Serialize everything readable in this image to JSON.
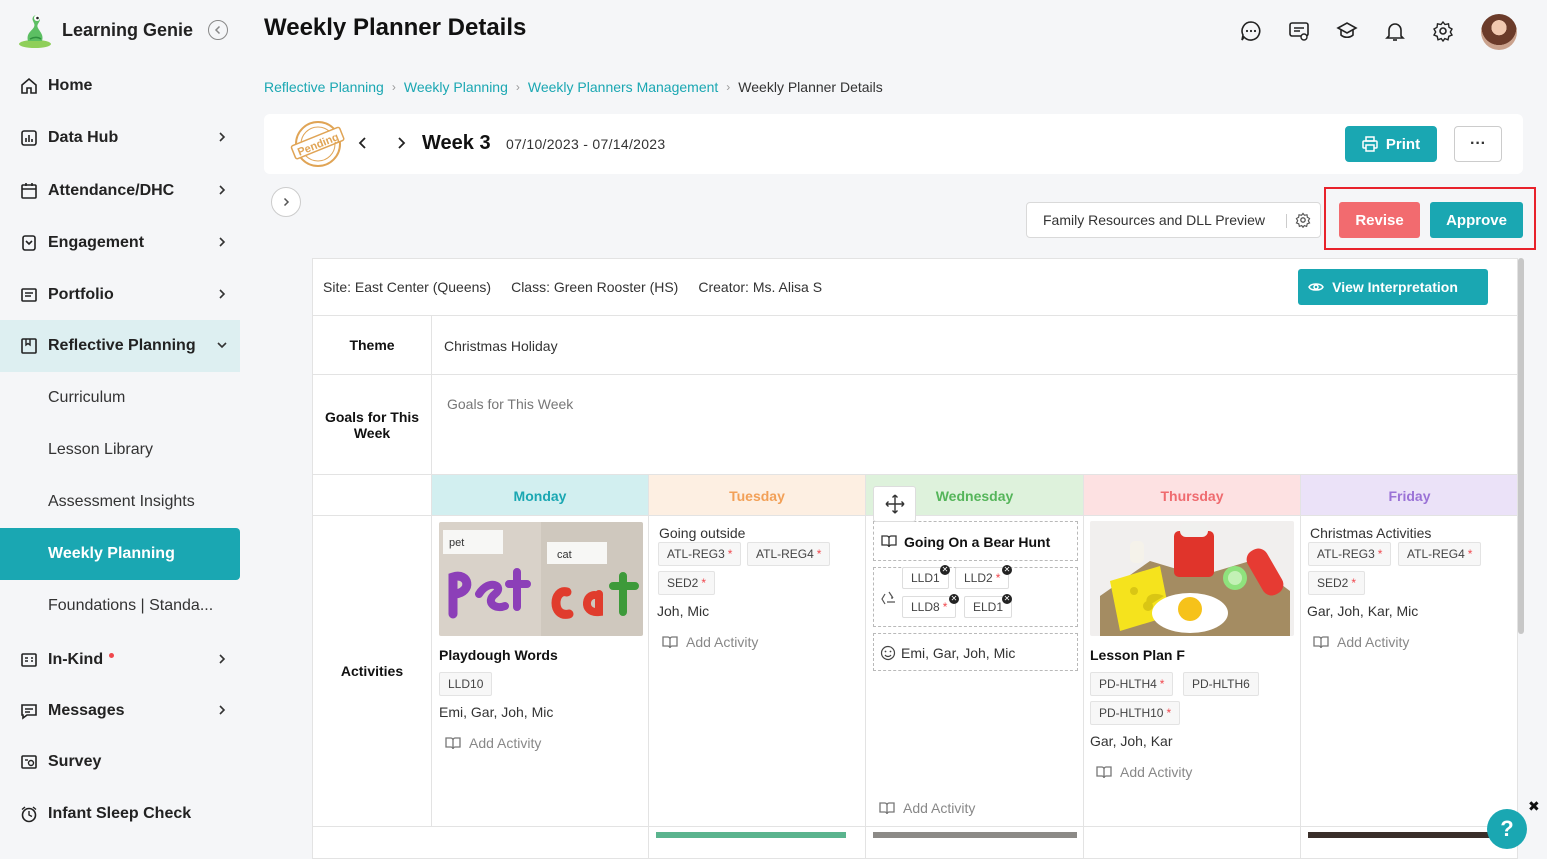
{
  "app": {
    "name": "Learning Genie"
  },
  "sidebar": {
    "items": [
      {
        "label": "Home"
      },
      {
        "label": "Data Hub"
      },
      {
        "label": "Attendance/DHC"
      },
      {
        "label": "Engagement"
      },
      {
        "label": "Portfolio"
      },
      {
        "label": "Reflective Planning"
      },
      {
        "label": "In-Kind"
      },
      {
        "label": "Messages"
      },
      {
        "label": "Survey"
      },
      {
        "label": "Infant Sleep Check"
      }
    ],
    "subitems": [
      {
        "label": "Curriculum"
      },
      {
        "label": "Lesson Library"
      },
      {
        "label": "Assessment Insights"
      },
      {
        "label": "Weekly Planning"
      },
      {
        "label": "Foundations | Standa..."
      }
    ]
  },
  "header": {
    "title": "Weekly Planner Details"
  },
  "breadcrumb": [
    {
      "label": "Reflective Planning"
    },
    {
      "label": "Weekly Planning"
    },
    {
      "label": "Weekly Planners Management"
    },
    {
      "label": "Weekly Planner Details"
    }
  ],
  "week": {
    "status": "Pending",
    "label": "Week 3",
    "dates": "07/10/2023 - 07/14/2023",
    "print_label": "Print",
    "more_label": "···"
  },
  "actions": {
    "preview_label": "Family Resources and DLL Preview",
    "revise_label": "Revise",
    "approve_label": "Approve"
  },
  "planner": {
    "site": "Site: East Center (Queens)",
    "class": "Class: Green Rooster (HS)",
    "creator": "Creator: Ms. Alisa S",
    "view_label": "View Interpretation",
    "theme_label": "Theme",
    "theme_value": "Christmas Holiday",
    "goals_label": "Goals for This Week",
    "goals_value": "Goals for This Week",
    "activities_label": "Activities",
    "add_activity": "Add Activity",
    "days": [
      {
        "name": "Monday",
        "color": "#1aa7b2",
        "bg": "#d2eff0"
      },
      {
        "name": "Tuesday",
        "color": "#f2a057",
        "bg": "#fdefe2"
      },
      {
        "name": "Wednesday",
        "color": "#55b55a",
        "bg": "#def2dc"
      },
      {
        "name": "Thursday",
        "color": "#ef6b6f",
        "bg": "#fde1e2"
      },
      {
        "name": "Friday",
        "color": "#9a72d6",
        "bg": "#ebe2f8"
      }
    ],
    "monday": {
      "title": "Playdough Words",
      "tags": [
        "LLD10"
      ],
      "children": "Emi, Gar, Joh, Mic",
      "img_words": [
        "pet",
        "cat"
      ]
    },
    "tuesday": {
      "title": "Going outside",
      "tags": [
        "ATL-REG3",
        "ATL-REG4",
        "SED2"
      ],
      "children": "Joh, Mic"
    },
    "wednesday": {
      "title": "Going On a Bear Hunt",
      "tags": [
        "LLD1",
        "LLD2",
        "LLD8",
        "ELD1"
      ],
      "children": "Emi, Gar, Joh, Mic"
    },
    "thursday": {
      "title": "Lesson Plan F",
      "tags": [
        "PD-HLTH4",
        "PD-HLTH6",
        "PD-HLTH10"
      ],
      "children": "Gar, Joh, Kar"
    },
    "friday": {
      "title": "Christmas Activities",
      "tags": [
        "ATL-REG3",
        "ATL-REG4",
        "SED2"
      ],
      "children": "Gar, Joh, Kar, Mic"
    }
  },
  "help": {
    "label": "?",
    "close": "✖"
  }
}
